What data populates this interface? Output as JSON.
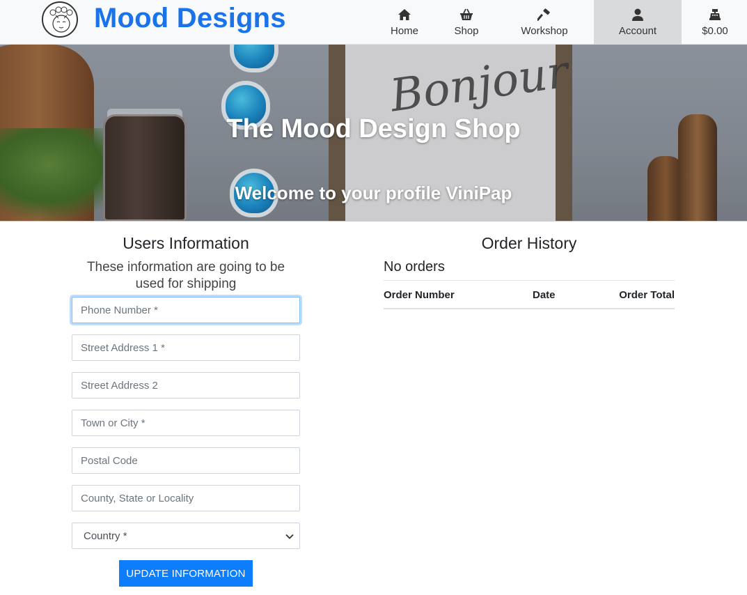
{
  "brand": {
    "name": "Mood Designs"
  },
  "nav": {
    "home": "Home",
    "shop": "Shop",
    "workshop": "Workshop",
    "account": "Account",
    "cart_total": "$0.00"
  },
  "hero": {
    "title": "The Mood Design Shop",
    "subtitle": "Welcome to your profile ViniPap",
    "frame_text": "Bonjour"
  },
  "users_info": {
    "title": "Users Information",
    "description": "These information are going to be used for shipping",
    "fields": {
      "phone": {
        "placeholder": "Phone Number *",
        "value": ""
      },
      "street1": {
        "placeholder": "Street Address 1 *",
        "value": ""
      },
      "street2": {
        "placeholder": "Street Address 2",
        "value": ""
      },
      "town": {
        "placeholder": "Town or City *",
        "value": ""
      },
      "postal": {
        "placeholder": "Postal Code",
        "value": ""
      },
      "county": {
        "placeholder": "County, State or Locality",
        "value": ""
      },
      "country": {
        "selected": "Country *"
      }
    },
    "submit_label": "UPDATE INFORMATION"
  },
  "order_history": {
    "title": "Order History",
    "empty_message": "No orders",
    "columns": [
      "Order Number",
      "Date",
      "Order Total"
    ]
  },
  "colors": {
    "brand": "#1a73e8",
    "button": "#0d7dfc",
    "active_nav": "#d9dadb"
  },
  "icons": {
    "home": "home-icon",
    "shop": "basket-icon",
    "workshop": "hammer-icon",
    "account": "user-icon",
    "cart": "cash-register-icon"
  }
}
